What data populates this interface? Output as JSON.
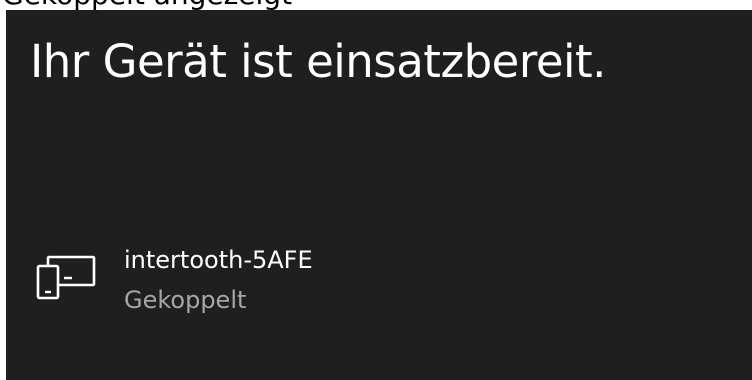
{
  "window": {
    "background_color": "#1f1f1f",
    "text_color": "#ffffff",
    "secondary_text_color": "#a6a6a6"
  },
  "top_strip": {
    "partial_text": "Gekoppelt angezeigt"
  },
  "panel": {
    "title": "Ihr Gerät ist einsatzbereit."
  },
  "device": {
    "icon": "devices-icon",
    "name": "intertooth-5AFE",
    "status": "Gekoppelt"
  }
}
